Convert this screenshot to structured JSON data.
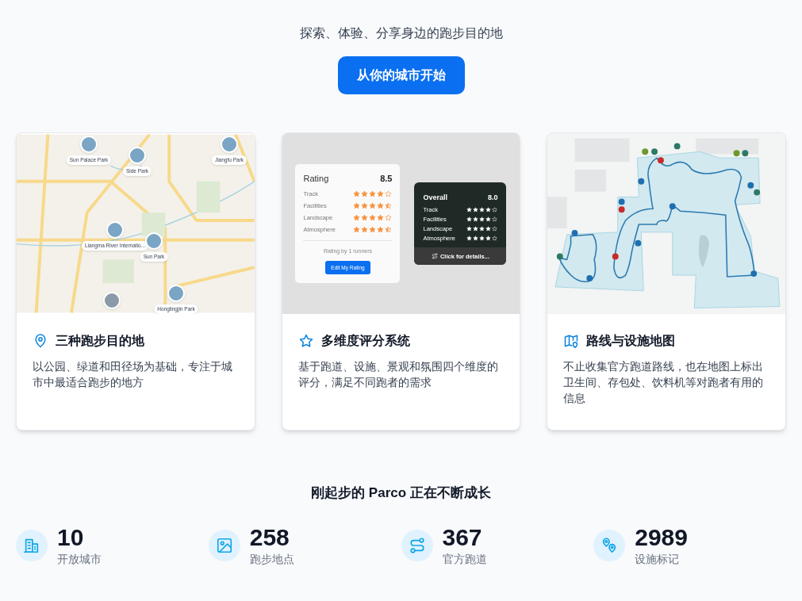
{
  "hero": {
    "tagline": "探索、体验、分享身边的跑步目的地",
    "cta": "从你的城市开始"
  },
  "features": [
    {
      "kind": "map",
      "title": "三种跑步目的地",
      "description": "以公园、绿道和田径场为基础，专注于城市中最适合跑步的地方",
      "places": [
        "Sun Palace Park",
        "Side Park",
        "Jiangfu Park",
        "Liangma River Internatio...",
        "Sun Park",
        "Honglingjin Park"
      ]
    },
    {
      "kind": "rating",
      "title": "多维度评分系统",
      "description": "基于跑道、设施、景观和氛围四个维度的评分，满足不同跑者的需求",
      "rating_card": {
        "title": "Rating",
        "score": "8.5",
        "rows": [
          {
            "label": "Track",
            "stars": 4
          },
          {
            "label": "Facilities",
            "stars": 4.5
          },
          {
            "label": "Landscape",
            "stars": 4
          },
          {
            "label": "Atmosphere",
            "stars": 4.5
          }
        ],
        "footer": "Rating by 1 runners",
        "button": "Edit My Rating"
      },
      "overlay_card": {
        "title": "Overall",
        "score": "8.0",
        "rows": [
          {
            "label": "Track",
            "stars": 4
          },
          {
            "label": "Facilities",
            "stars": 4
          },
          {
            "label": "Landscape",
            "stars": 4
          },
          {
            "label": "Atmosphere",
            "stars": 4
          }
        ],
        "hint": "Click for details..."
      }
    },
    {
      "kind": "route",
      "title": "路线与设施地图",
      "description": "不止收集官方跑道路线，也在地图上标出卫生间、存包处、饮料机等对跑者有用的信息"
    }
  ],
  "growth": {
    "title": "刚起步的 Parco 正在不断成长",
    "stats": [
      {
        "value": "10",
        "label": "开放城市"
      },
      {
        "value": "258",
        "label": "跑步地点"
      },
      {
        "value": "367",
        "label": "官方跑道"
      },
      {
        "value": "2989",
        "label": "设施标记"
      }
    ]
  }
}
